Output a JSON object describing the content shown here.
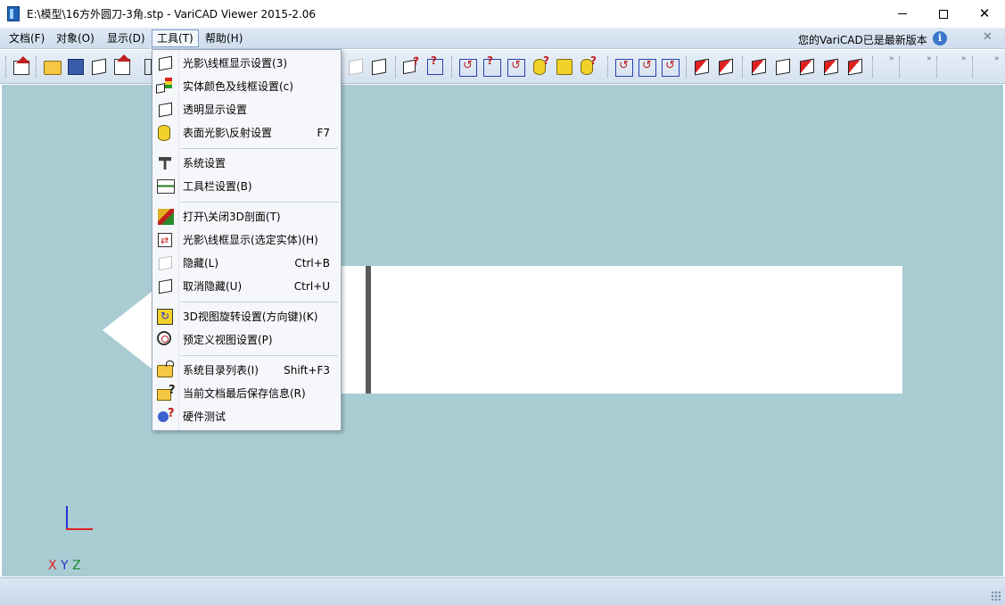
{
  "window": {
    "title": "E:\\模型\\16方外圆刀-3角.stp - VariCAD Viewer 2015-2.06",
    "minimize_label": "",
    "maximize_label": "",
    "close_label": "✕"
  },
  "menubar": {
    "items": [
      {
        "label": "文档(F)"
      },
      {
        "label": "对象(O)"
      },
      {
        "label": "显示(D)"
      },
      {
        "label": "工具(T)"
      },
      {
        "label": "帮助(H)"
      }
    ],
    "update_notice": "您的VariCAD已是最新版本",
    "info_icon_glyph": "i",
    "close_glyph": "✕"
  },
  "toolbar": {
    "overflow_glyph": "»"
  },
  "tools_menu": {
    "items": [
      {
        "label": "光影\\线框显示设置(3)",
        "shortcut": ""
      },
      {
        "label": "实体颜色及线框设置(c)",
        "shortcut": ""
      },
      {
        "label": "透明显示设置",
        "shortcut": ""
      },
      {
        "label": "表面光影\\反射设置",
        "shortcut": "F7"
      },
      {
        "label": "系统设置",
        "shortcut": ""
      },
      {
        "label": "工具栏设置(B)",
        "shortcut": ""
      },
      {
        "label": "打开\\关闭3D剖面(T)",
        "shortcut": ""
      },
      {
        "label": "光影\\线框显示(选定实体)(H)",
        "shortcut": ""
      },
      {
        "label": "隐藏(L)",
        "shortcut": "Ctrl+B"
      },
      {
        "label": "取消隐藏(U)",
        "shortcut": "Ctrl+U"
      },
      {
        "label": "3D视图旋转设置(方向键)(K)",
        "shortcut": ""
      },
      {
        "label": "预定义视图设置(P)",
        "shortcut": ""
      },
      {
        "label": "系统目录列表(I)",
        "shortcut": "Shift+F3"
      },
      {
        "label": "当前文档最后保存信息(R)",
        "shortcut": ""
      },
      {
        "label": "硬件测试",
        "shortcut": ""
      }
    ]
  },
  "viewport": {
    "axis_x": "X",
    "axis_y": "Y",
    "axis_z": "Z",
    "background_color": "#a9ccd3"
  }
}
